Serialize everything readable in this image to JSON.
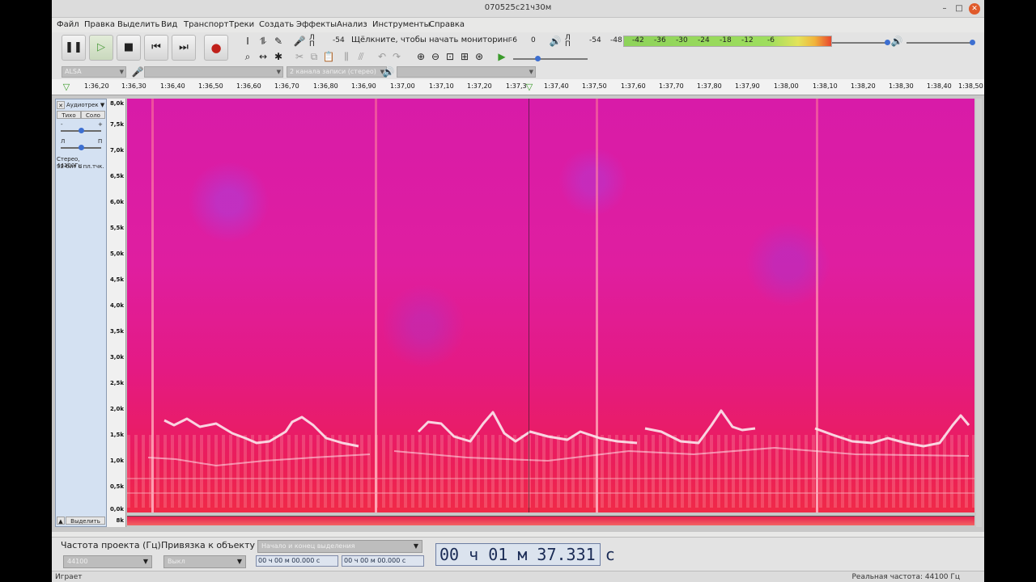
{
  "window": {
    "title": "070525c21ч30м"
  },
  "menu": [
    "Файл",
    "Правка",
    "Выделить",
    "Вид",
    "Транспорт",
    "Треки",
    "Создать",
    "Эффекты",
    "Анализ",
    "Инструменты",
    "Справка"
  ],
  "meters": {
    "rec_channel_l": "Л",
    "rec_channel_r": "П",
    "rec_scale": [
      "-54",
      "-6",
      "0"
    ],
    "monitor_prompt": "Щёлкните, чтобы начать мониторинг",
    "play_channel_l": "Л",
    "play_channel_r": "П",
    "play_scale": [
      "-54",
      "-48",
      "-42",
      "-36",
      "-30",
      "-24",
      "-18",
      "-12",
      "-6"
    ],
    "play_level_fraction": 0.97
  },
  "device": {
    "host": "ALSA",
    "record_channels": "2 канала записи (стерео)"
  },
  "ruler": {
    "ticks": [
      "1:36,20",
      "1:36,30",
      "1:36,40",
      "1:36,50",
      "1:36,60",
      "1:36,70",
      "1:36,80",
      "1:36,90",
      "1:37,00",
      "1:37,10",
      "1:37,20",
      "1:37,30",
      "1:37,40",
      "1:37,50",
      "1:37,60",
      "1:37,70",
      "1:37,80",
      "1:37,90",
      "1:38,00",
      "1:38,10",
      "1:38,20",
      "1:38,30",
      "1:38,40",
      "1:38,50"
    ]
  },
  "track": {
    "name": "Аудиотрек",
    "mute": "Тихо",
    "solo": "Соло",
    "pan_left": "Л",
    "pan_right": "П",
    "gain_minus": "-",
    "gain_plus": "+",
    "info1": "Стерео, 44100Гц",
    "info2": "32-бит с пл.тчк.",
    "select": "Выделить",
    "freq_labels": [
      "8,0k",
      "7,5k",
      "7,0k",
      "6,5k",
      "6,0k",
      "5,5k",
      "5,0k",
      "4,5k",
      "4,0k",
      "3,5k",
      "3,0k",
      "2,5k",
      "2,0k",
      "1,5k",
      "1,0k",
      "0,5k",
      "0,0k"
    ],
    "second_channel_label": "8k"
  },
  "selection": {
    "rate_label": "Частота проекта (Гц)",
    "rate_value": "44100",
    "snap_label": "Привязка к объекту",
    "snap_value": "Выкл",
    "mode": "Начало и конец выделения",
    "start": "00 ч 00 м 00.000 с",
    "end": "00 ч 00 м 00.000 с"
  },
  "clock": {
    "time": "00 ч 01 м 37.331 с"
  },
  "status": {
    "left": "Играет",
    "right": "Реальная частота: 44100 Гц"
  }
}
